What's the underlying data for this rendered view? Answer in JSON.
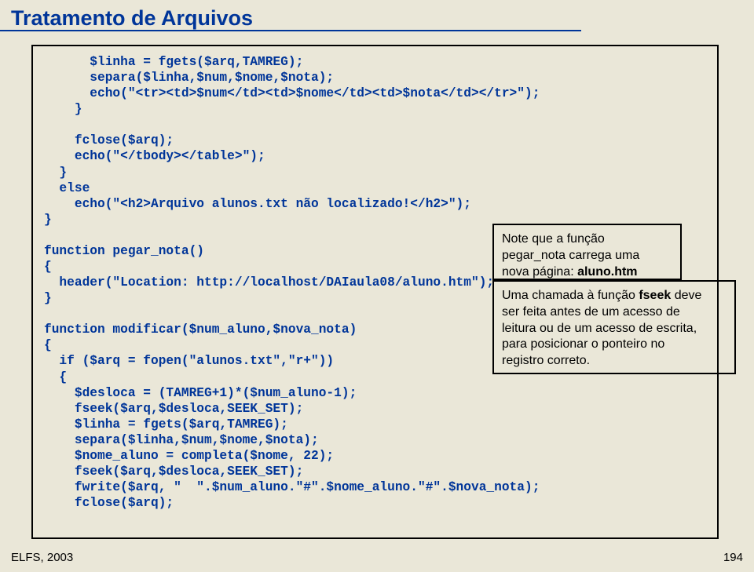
{
  "title": "Tratamento de Arquivos",
  "code": "      $linha = fgets($arq,TAMREG);\n      separa($linha,$num,$nome,$nota);\n      echo(\"<tr><td>$num</td><td>$nome</td><td>$nota</td></tr>\");\n    }\n\n    fclose($arq);\n    echo(\"</tbody></table>\");\n  }\n  else\n    echo(\"<h2>Arquivo alunos.txt não localizado!</h2>\");\n}\n\nfunction pegar_nota()\n{\n  header(\"Location: http://localhost/DAIaula08/aluno.htm\");\n}\n\nfunction modificar($num_aluno,$nova_nota)\n{\n  if ($arq = fopen(\"alunos.txt\",\"r+\"))\n  {\n    $desloca = (TAMREG+1)*($num_aluno-1);\n    fseek($arq,$desloca,SEEK_SET);\n    $linha = fgets($arq,TAMREG);\n    separa($linha,$num,$nome,$nota);\n    $nome_aluno = completa($nome, 22);\n    fseek($arq,$desloca,SEEK_SET);\n    fwrite($arq, \"  \".$num_aluno.\"#\".$nome_aluno.\"#\".$nova_nota);\n    fclose($arq);",
  "callout1": {
    "l1": "Note que a função",
    "l2": "pegar_nota carrega uma",
    "l3a": "nova página: ",
    "l3b": "aluno.htm"
  },
  "callout2": {
    "l1a": "Uma chamada à função ",
    "l1b": "fseek",
    "l1c": " deve",
    "l2": "ser feita antes de um acesso de",
    "l3": "leitura ou de um acesso de escrita,",
    "l4": "para posicionar o ponteiro no",
    "l5": "registro correto."
  },
  "footer": {
    "left": "ELFS, 2003",
    "right": "194"
  }
}
